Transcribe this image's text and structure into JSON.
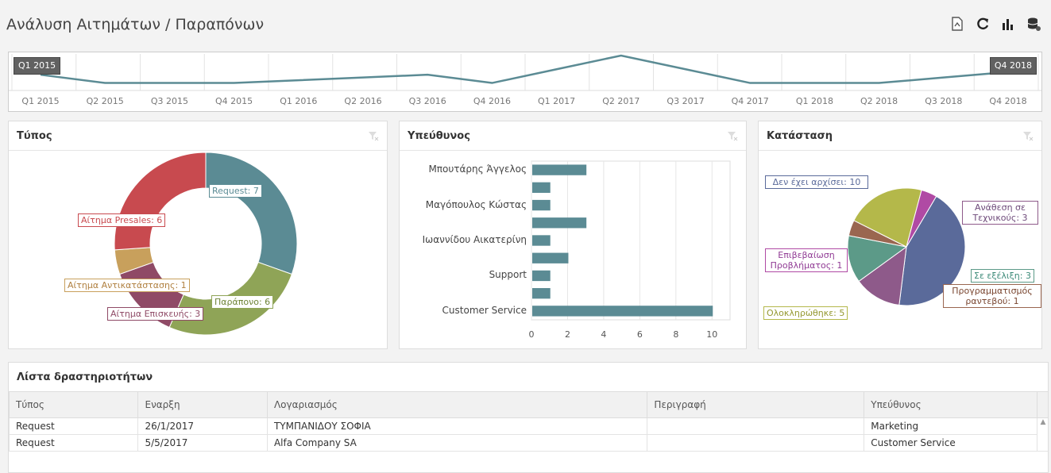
{
  "page": {
    "title": "Ανάλυση Αιτημάτων / Παραπόνων"
  },
  "toolbar": {
    "icons": [
      "export-icon",
      "refresh-icon",
      "bar-chart-icon",
      "database-icon"
    ]
  },
  "timeline": {
    "start_handle": "Q1 2015",
    "end_handle": "Q4 2018",
    "quarters": [
      "Q1 2015",
      "Q2 2015",
      "Q3 2015",
      "Q4 2015",
      "Q1 2016",
      "Q2 2016",
      "Q3 2016",
      "Q4 2016",
      "Q1 2017",
      "Q2 2017",
      "Q3 2017",
      "Q4 2017",
      "Q1 2018",
      "Q2 2018",
      "Q3 2018",
      "Q4 2018"
    ],
    "values": [
      4,
      1,
      1,
      1,
      2,
      3,
      4,
      1,
      6,
      11,
      6,
      1,
      1,
      1,
      3,
      5
    ]
  },
  "panels": {
    "type": {
      "title": "Τύπος"
    },
    "owner": {
      "title": "Υπεύθυνος"
    },
    "status": {
      "title": "Κατάσταση"
    },
    "activities": {
      "title": "Λίστα δραστηριοτήτων"
    }
  },
  "chart_data": [
    {
      "type": "pie",
      "variant": "donut",
      "slices": [
        {
          "label": "Request: 7",
          "value": 7,
          "color": "#5b8b94"
        },
        {
          "label": "Παράπονο: 6",
          "value": 6,
          "color": "#8fa457"
        },
        {
          "label": "Αίτημα Επισκευής: 3",
          "value": 3,
          "color": "#8f4a66"
        },
        {
          "label": "Αίτημα Αντικατάστασης: 1",
          "value": 1,
          "color": "#c8a05c"
        },
        {
          "label": "Αίτημα Presales: 6",
          "value": 6,
          "color": "#c84a4f"
        }
      ]
    },
    {
      "type": "bar",
      "orientation": "horizontal",
      "categories": [
        "Μπουτάρης Άγγελος",
        "",
        "Μαγόπουλος Κώστας",
        "",
        "Ιωαννίδου Αικατερίνη",
        "",
        "Support",
        "",
        "Customer Service"
      ],
      "values": [
        3,
        1,
        1,
        3,
        1,
        2,
        1,
        1,
        10
      ],
      "xticks": [
        "0",
        "2",
        "4",
        "6",
        "8",
        "10"
      ],
      "xlim": [
        0,
        11
      ],
      "color": "#5b8b94"
    },
    {
      "type": "pie",
      "slices": [
        {
          "label": "Δεν έχει αρχίσει: 10",
          "value": 10,
          "color": "#5a6a9a"
        },
        {
          "label": "Ανάθεση σε Τεχνικούς: 3",
          "value": 3,
          "color": "#8e5a8a"
        },
        {
          "label": "Σε εξέλιξη: 3",
          "value": 3,
          "color": "#5c9a88"
        },
        {
          "label": "Προγραμματισμός ραντεβού: 1",
          "value": 1,
          "color": "#9a6650"
        },
        {
          "label": "Ολοκληρώθηκε: 5",
          "value": 5,
          "color": "#b4b84a"
        },
        {
          "label": "Επιβεβαίωση Προβλήματος: 1",
          "value": 1,
          "color": "#b04aa4"
        }
      ]
    }
  ],
  "table": {
    "columns": [
      "Τύπος",
      "Εναρξη",
      "Λογαριασμός",
      "Περιγραφή",
      "Υπεύθυνος"
    ],
    "rows": [
      [
        "Request",
        "26/1/2017",
        "ΤΥΜΠΑΝΙΔΟΥ ΣΟΦΙΑ",
        "",
        "Marketing"
      ],
      [
        "Request",
        "5/5/2017",
        "Alfa Company SA",
        "",
        "Customer Service"
      ]
    ]
  }
}
